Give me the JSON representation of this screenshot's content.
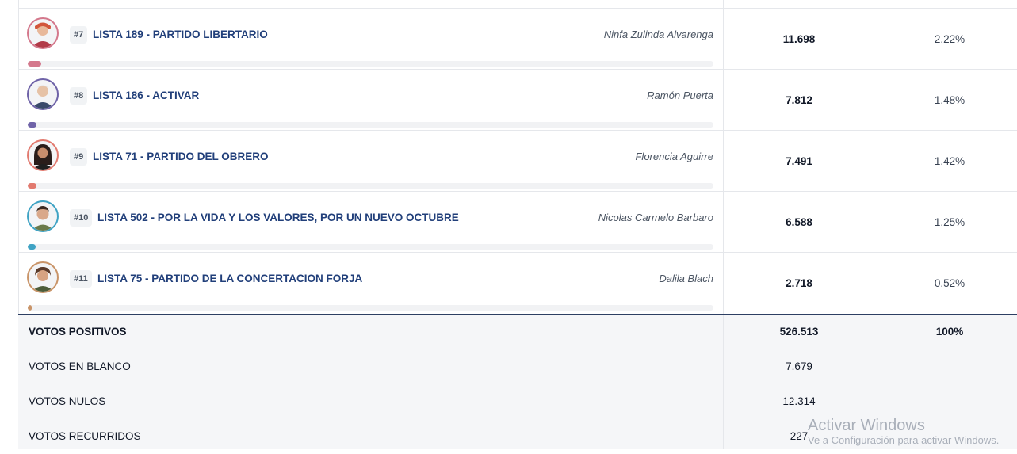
{
  "rows": [
    {
      "rank": "#7",
      "party": "LISTA 189 - PARTIDO LIBERTARIO",
      "candidate": "Ninfa Zulinda Alvarenga",
      "votes": "11.698",
      "percent": "2,22%",
      "share": 2.22,
      "color": "#d4788c",
      "avatar_icon": "candidate-photo-icon"
    },
    {
      "rank": "#8",
      "party": "LISTA 186 - ACTIVAR",
      "candidate": "Ramón Puerta",
      "votes": "7.812",
      "percent": "1,48%",
      "share": 1.48,
      "color": "#6f63a8",
      "avatar_icon": "candidate-photo-icon"
    },
    {
      "rank": "#9",
      "party": "LISTA 71 - PARTIDO DEL OBRERO",
      "candidate": "Florencia Aguirre",
      "votes": "7.491",
      "percent": "1,42%",
      "share": 1.42,
      "color": "#e27a6f",
      "avatar_icon": "candidate-photo-icon"
    },
    {
      "rank": "#10",
      "party": "LISTA 502 - POR LA VIDA Y LOS VALORES, POR UN NUEVO OCTUBRE",
      "candidate": "Nicolas Carmelo Barbaro",
      "votes": "6.588",
      "percent": "1,25%",
      "share": 1.25,
      "color": "#3fa3c4",
      "avatar_icon": "candidate-photo-icon"
    },
    {
      "rank": "#11",
      "party": "LISTA 75 - PARTIDO DE LA CONCERTACION FORJA",
      "candidate": "Dalila Blach",
      "votes": "2.718",
      "percent": "0,52%",
      "share": 0.52,
      "color": "#c99468",
      "avatar_icon": "candidate-photo-icon"
    }
  ],
  "summary": [
    {
      "label": "VOTOS POSITIVOS",
      "votes": "526.513",
      "percent": "100%"
    },
    {
      "label": "VOTOS EN BLANCO",
      "votes": "7.679",
      "percent": ""
    },
    {
      "label": "VOTOS NULOS",
      "votes": "12.314",
      "percent": ""
    },
    {
      "label": "VOTOS RECURRIDOS",
      "votes": "227",
      "percent": ""
    }
  ],
  "watermark": {
    "title": "Activar Windows",
    "subtitle": "Ve a Configuración para activar Windows."
  }
}
